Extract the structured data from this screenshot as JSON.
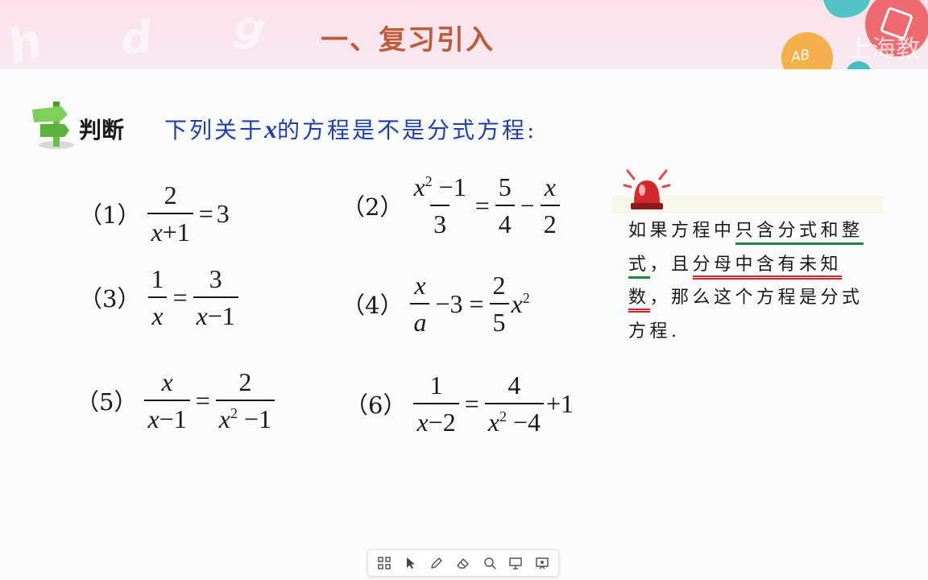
{
  "header": {
    "title": "一、复习引入",
    "decor_letters": [
      "h",
      "d",
      "g"
    ],
    "badge_text": "AB",
    "watermark": "上海教育"
  },
  "question": {
    "label": "判断",
    "text_before": "下列关于",
    "variable": "x",
    "text_after": "的方程是不是分式方程:"
  },
  "equations": {
    "e1": {
      "label": "（1）",
      "num": "2",
      "den_var": "x",
      "den_rest": "+1",
      "rhs": "3"
    },
    "e2": {
      "label": "（2）",
      "num_var": "x",
      "num_exp": "2",
      "num_rest": " −1",
      "den": "3",
      "f2_num": "5",
      "f2_den": "4",
      "f3_num": "x",
      "f3_den": "2"
    },
    "e3": {
      "label": "（3）",
      "f1_num": "1",
      "f1_den": "x",
      "f2_num": "3",
      "f2_den_var": "x",
      "f2_den_rest": "−1"
    },
    "e4": {
      "label": "（4）",
      "f1_num": "x",
      "f1_den": "a",
      "minus": "−3",
      "f2_num": "2",
      "f2_den": "5",
      "tail_var": "x",
      "tail_exp": "2"
    },
    "e5": {
      "label": "（5）",
      "f1_num": "x",
      "f1_den_var": "x",
      "f1_den_rest": "−1",
      "f2_num": "2",
      "f2_den_var": "x",
      "f2_den_exp": "2",
      "f2_den_rest": " −1"
    },
    "e6": {
      "label": "（6）",
      "f1_num": "1",
      "f1_den_var": "x",
      "f1_den_rest": "−2",
      "f2_num": "4",
      "f2_den_var": "x",
      "f2_den_exp": "2",
      "f2_den_rest": " −4",
      "tail": "+1"
    }
  },
  "tip": {
    "p1": "如果方程中",
    "p2": "只含分式和整式",
    "p3": "，且",
    "p4": "分母中含有未知数",
    "p5": "，那么这个方程是分式方程."
  },
  "toolbar": {
    "items": [
      "grid-icon",
      "pointer-icon",
      "pen-icon",
      "eraser-icon",
      "search-icon",
      "spotlight-icon",
      "whiteboard-icon"
    ]
  },
  "colors": {
    "title": "#c05a3a",
    "question_text": "#1d3fb2",
    "green_underline": "#1b8a3a",
    "red_underline": "#c8262a"
  }
}
